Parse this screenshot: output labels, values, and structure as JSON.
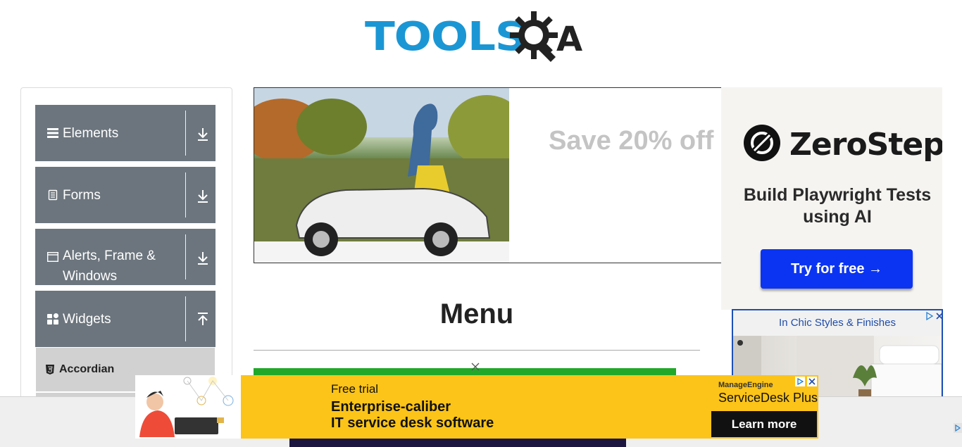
{
  "header": {
    "logo_text": "TOOLS",
    "logo_suffix": "QA"
  },
  "sidebar": {
    "groups": [
      {
        "label": "Elements",
        "icon": "hamburger-icon",
        "arrow": "download-icon"
      },
      {
        "label": "Forms",
        "icon": "document-icon",
        "arrow": "download-icon"
      },
      {
        "label": "Alerts, Frame & Windows",
        "icon": "window-icon",
        "arrow": "download-icon"
      },
      {
        "label": "Widgets",
        "icon": "grid-icon",
        "arrow": "upload-icon"
      }
    ],
    "sub_items": [
      {
        "label": "Accordian",
        "icon": "html5-icon"
      }
    ]
  },
  "banner_ad": {
    "headline": "Save 20% off"
  },
  "side_ad": {
    "brand": "ZeroStep",
    "tagline": "Build Playwright Tests using AI",
    "cta": "Try for free →",
    "accent": "#0b34f2"
  },
  "side_ad2": {
    "title": "In Chic Styles & Finishes"
  },
  "main": {
    "title": "Menu"
  },
  "bottom_ad": {
    "line1": "Free trial",
    "line2": "Enterprise-caliber",
    "line3": "IT service desk software",
    "brand": "ManageEngine",
    "product": "ServiceDesk Plus",
    "cta": "Learn more",
    "background": "#fcc418"
  },
  "colors": {
    "sidebar_group": "#6c757d",
    "sub_item": "#d1d1d1",
    "logo_blue": "#1b96d4",
    "green_bar": "#21a829"
  }
}
